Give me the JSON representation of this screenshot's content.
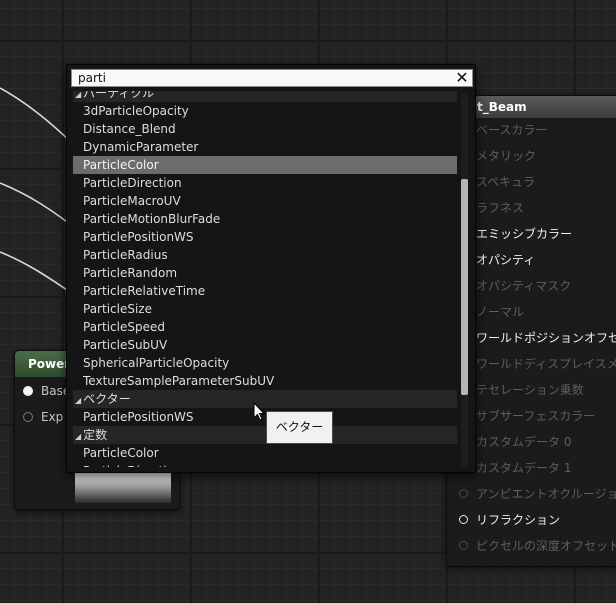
{
  "search": {
    "query": "parti",
    "clear_icon": "close-icon"
  },
  "menu": {
    "clipped_category": "パーティクル",
    "rows": [
      {
        "label": "3dParticleOpacity",
        "kind": "item"
      },
      {
        "label": "Distance_Blend",
        "kind": "item"
      },
      {
        "label": "DynamicParameter",
        "kind": "item"
      },
      {
        "label": "ParticleColor",
        "kind": "item",
        "selected": true
      },
      {
        "label": "ParticleDirection",
        "kind": "item"
      },
      {
        "label": "ParticleMacroUV",
        "kind": "item"
      },
      {
        "label": "ParticleMotionBlurFade",
        "kind": "item"
      },
      {
        "label": "ParticlePositionWS",
        "kind": "item"
      },
      {
        "label": "ParticleRadius",
        "kind": "item"
      },
      {
        "label": "ParticleRandom",
        "kind": "item"
      },
      {
        "label": "ParticleRelativeTime",
        "kind": "item"
      },
      {
        "label": "ParticleSize",
        "kind": "item"
      },
      {
        "label": "ParticleSpeed",
        "kind": "item"
      },
      {
        "label": "ParticleSubUV",
        "kind": "item"
      },
      {
        "label": "SphericalParticleOpacity",
        "kind": "item"
      },
      {
        "label": "TextureSampleParameterSubUV",
        "kind": "item"
      },
      {
        "label": "ベクター",
        "kind": "category"
      },
      {
        "label": "ParticlePositionWS",
        "kind": "item"
      },
      {
        "label": "定数",
        "kind": "category"
      },
      {
        "label": "ParticleColor",
        "kind": "item"
      },
      {
        "label": "ParticleDirection",
        "kind": "item"
      }
    ]
  },
  "tooltip": {
    "text": "ベクター"
  },
  "power_node": {
    "title": "Power(",
    "pins": [
      {
        "label": "Base",
        "connected": true
      },
      {
        "label": "Exp",
        "connected": false
      }
    ]
  },
  "material_node": {
    "title": "t_Beam",
    "pins": [
      {
        "label": "ベースカラー",
        "active": false
      },
      {
        "label": "メタリック",
        "active": false
      },
      {
        "label": "スペキュラ",
        "active": false
      },
      {
        "label": "ラフネス",
        "active": false
      },
      {
        "label": "エミッシブカラー",
        "active": true
      },
      {
        "label": "オパシティ",
        "active": true
      },
      {
        "label": "オパシティマスク",
        "active": false
      },
      {
        "label": "ノーマル",
        "active": false
      },
      {
        "label": "ワールドポジションオフセット",
        "active": true
      },
      {
        "label": "ワールドディスプレイスメント",
        "active": false
      },
      {
        "label": "テセレーション乗数",
        "active": false
      },
      {
        "label": "サブサーフェスカラー",
        "active": false
      },
      {
        "label": "カスタムデータ 0",
        "active": false
      },
      {
        "label": "カスタムデータ 1",
        "active": false
      },
      {
        "label": "アンビエントオクルージョン",
        "active": false
      },
      {
        "label": "リフラクション",
        "active": true
      },
      {
        "label": "ピクセルの深度オフセット",
        "active": false
      }
    ]
  },
  "colors": {
    "power_header": "#3d5c3c",
    "selection": "#6c6c6c",
    "scroll_thumb": "#b5b5b5"
  }
}
